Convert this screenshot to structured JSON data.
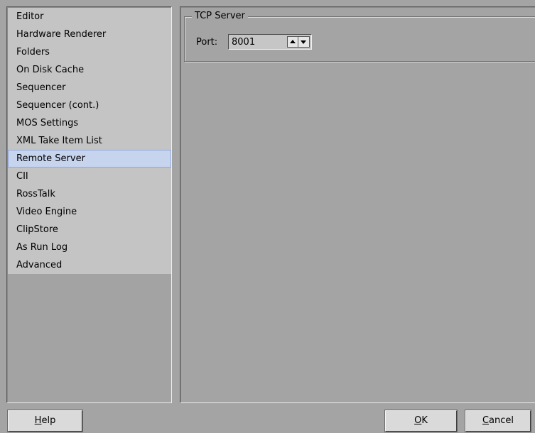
{
  "sidebar": {
    "items": [
      {
        "label": "Editor",
        "selected": false
      },
      {
        "label": "Hardware Renderer",
        "selected": false
      },
      {
        "label": "Folders",
        "selected": false
      },
      {
        "label": "On Disk Cache",
        "selected": false
      },
      {
        "label": "Sequencer",
        "selected": false
      },
      {
        "label": "Sequencer (cont.)",
        "selected": false
      },
      {
        "label": "MOS Settings",
        "selected": false
      },
      {
        "label": "XML Take Item List",
        "selected": false
      },
      {
        "label": "Remote Server",
        "selected": true
      },
      {
        "label": "CII",
        "selected": false
      },
      {
        "label": "RossTalk",
        "selected": false
      },
      {
        "label": "Video Engine",
        "selected": false
      },
      {
        "label": "ClipStore",
        "selected": false
      },
      {
        "label": "As Run Log",
        "selected": false
      },
      {
        "label": "Advanced",
        "selected": false
      }
    ]
  },
  "tcp_server": {
    "group_title": "TCP Server",
    "port_label": "Port:",
    "port_value": "8001"
  },
  "buttons": {
    "help": {
      "mnemonic": "H",
      "rest": "elp"
    },
    "ok": {
      "mnemonic": "O",
      "rest": "K"
    },
    "cancel": {
      "mnemonic": "C",
      "rest": "ancel"
    }
  },
  "icons": {
    "spin_up": "triangle-up-icon",
    "spin_down": "triangle-down-icon"
  },
  "colors": {
    "selection_fill": "#c6d4ee",
    "selection_border": "#92a8d8",
    "dialog_background": "#a4a4a4",
    "list_background": "#c4c4c4"
  }
}
